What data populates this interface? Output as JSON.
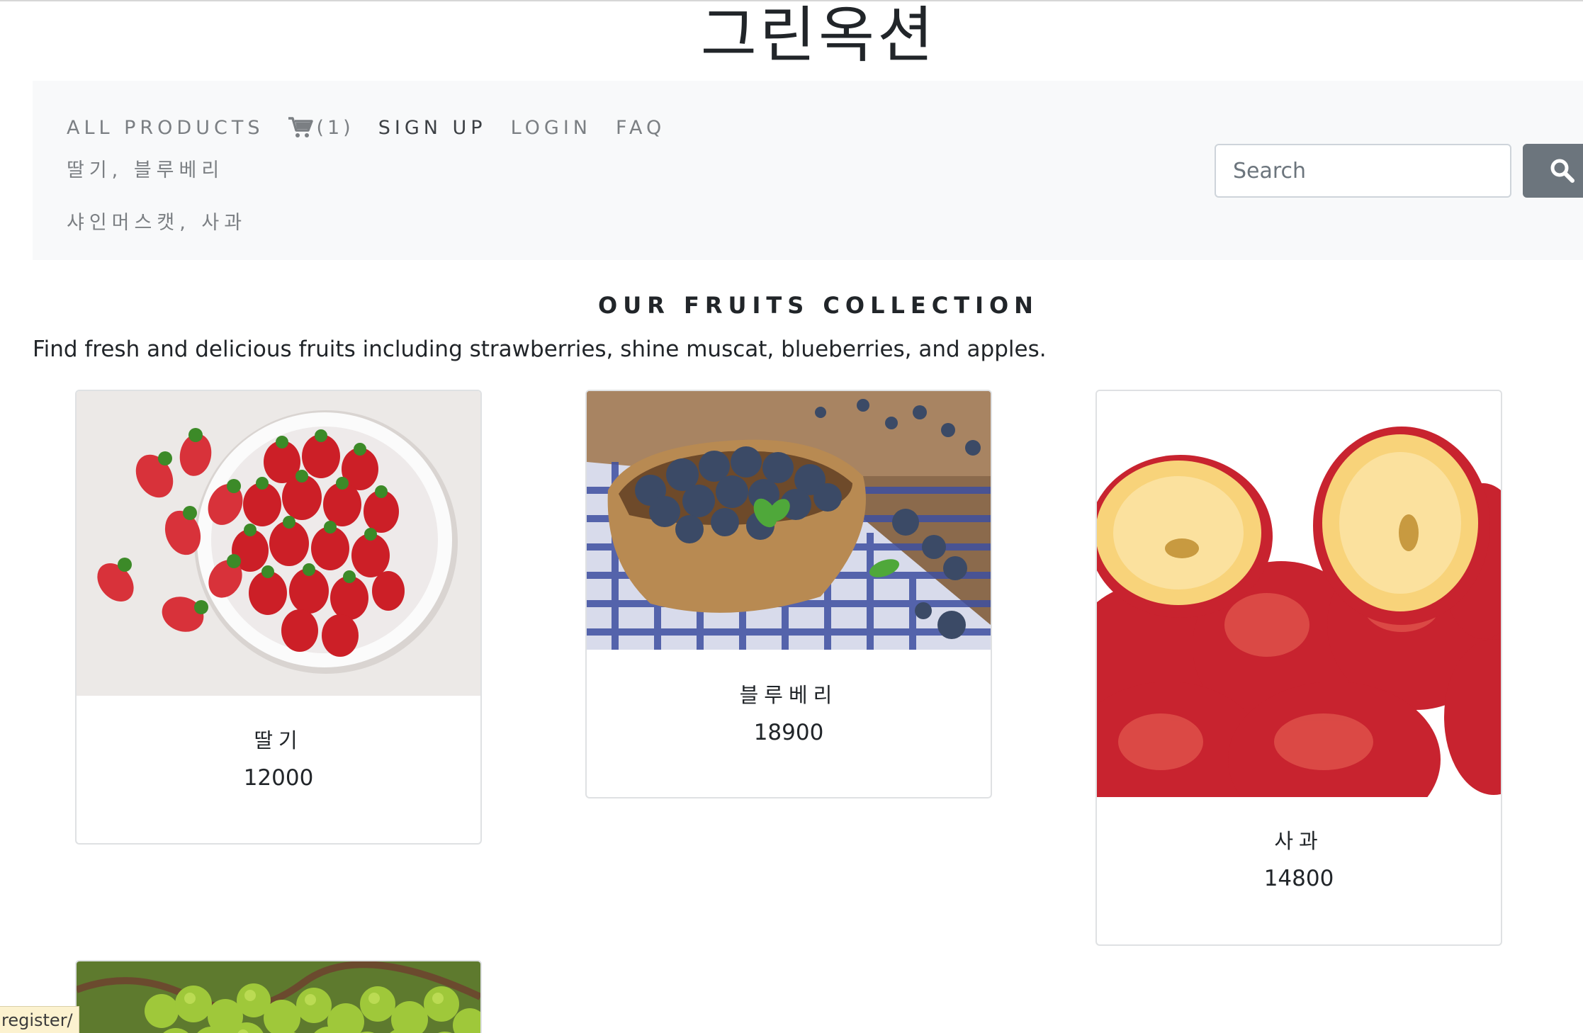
{
  "site": {
    "title": "그린옥션"
  },
  "nav": {
    "all_products": "ALL PRODUCTS",
    "cart_icon": "cart-icon",
    "cart_count": "(1)",
    "sign_up": "SIGN UP",
    "login": "LOGIN",
    "faq": "FAQ",
    "sub_links": [
      "딸기, 블루베리",
      "샤인머스캣, 사과"
    ]
  },
  "search": {
    "placeholder": "Search",
    "value": "",
    "button_icon": "search-icon",
    "button_color": "#6c757d"
  },
  "collection": {
    "title": "OUR FRUITS COLLECTION",
    "description": "Find fresh and delicious fruits including strawberries, shine muscat, blueberries, and apples."
  },
  "products": [
    {
      "name": "딸기",
      "price": "12000",
      "image": "strawberry-image"
    },
    {
      "name": "블루베리",
      "price": "18900",
      "image": "blueberry-image"
    },
    {
      "name": "사과",
      "price": "14800",
      "image": "apple-image"
    },
    {
      "name": "",
      "price": "",
      "image": "shine-muscat-image"
    }
  ],
  "status_bar": {
    "text": "register/"
  },
  "colors": {
    "navbar_bg": "#f8f9fa",
    "link": "#7b7f83",
    "text": "#212529",
    "status_bg": "#fcf2cf"
  }
}
